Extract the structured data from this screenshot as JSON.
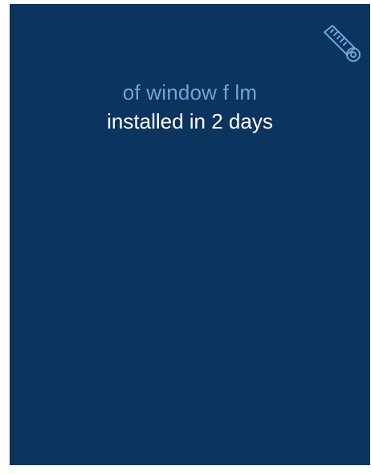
{
  "card": {
    "icon": "film-roll-ruler-icon",
    "headline_line1": "of window f lm",
    "headline_line2": "installed in 2 days"
  },
  "colors": {
    "background": "#0b345e",
    "accent": "#6fa4d9",
    "text": "#ffffff"
  }
}
